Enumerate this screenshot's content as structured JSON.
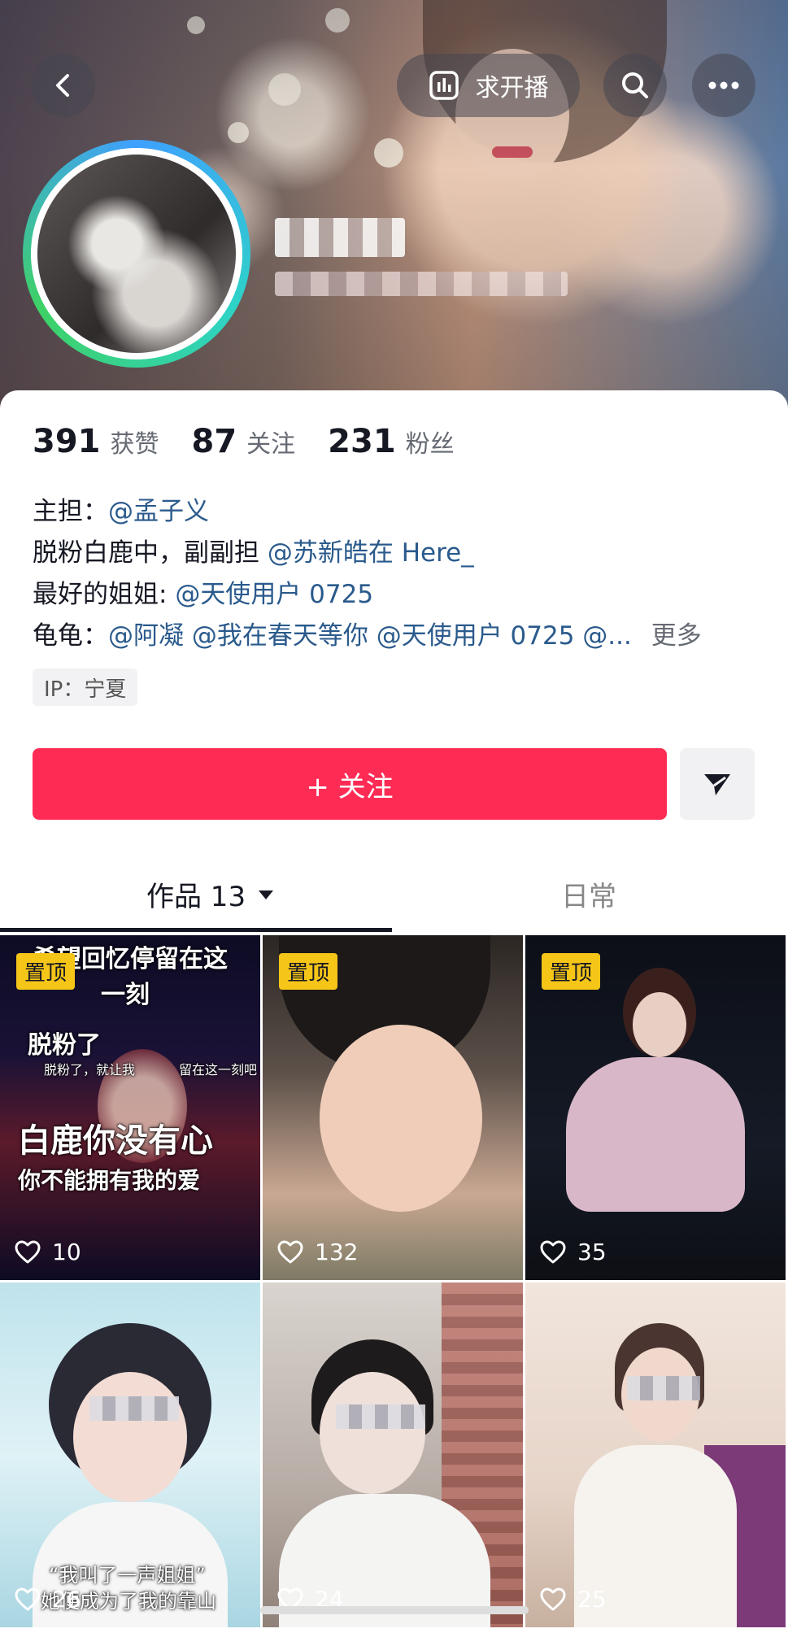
{
  "header": {
    "back_icon": "chevron-left-icon",
    "live_request_label": "求开播",
    "live_request_icon": "chart-bars-icon",
    "search_icon": "search-icon",
    "more_icon": "more-horizontal-icon"
  },
  "profile": {
    "stats": [
      {
        "value": "391",
        "label": "获赞"
      },
      {
        "value": "87",
        "label": "关注"
      },
      {
        "value": "231",
        "label": "粉丝"
      }
    ],
    "bio": {
      "line1": {
        "prefix": "主担：",
        "mentions": "@孟子义"
      },
      "line2": {
        "prefix": "脱粉白鹿中，副副担 ",
        "mentions": "@苏新皓在 Here_"
      },
      "line3": {
        "prefix": "最好的姐姐: ",
        "mentions": "@天使用户 0725"
      },
      "line4": {
        "prefix": "龟龟：",
        "mentions": "@阿凝 @我在春天等你 @天使用户 0725 @...",
        "more": "更多"
      }
    },
    "ip_label": "IP：宁夏"
  },
  "actions": {
    "follow_label": "+ 关注",
    "share_icon": "send-icon"
  },
  "tabs": {
    "works": "作品 13",
    "daily": "日常"
  },
  "grid": {
    "items": [
      {
        "likes": "10",
        "pinned": "置顶",
        "texts": {
          "t1": "希望回忆停留在这",
          "t2": "一刻",
          "t3": "脱粉了",
          "t4": "脱粉了，就让我",
          "t5": "留在这一刻吧",
          "t6": "白鹿你没有心",
          "t7": "你不能拥有我的爱"
        }
      },
      {
        "likes": "132",
        "pinned": "置顶"
      },
      {
        "likes": "35",
        "pinned": "置顶"
      },
      {
        "likes": "26",
        "texts": {
          "t1": "“我叫了一声姐姐”",
          "t2": "她便成为了我的靠山"
        }
      },
      {
        "likes": "24"
      },
      {
        "likes": "25"
      }
    ]
  },
  "colors": {
    "accent": "#fe2c55",
    "mention": "#2a5a8c",
    "pinned_badge": "#f5c518"
  }
}
